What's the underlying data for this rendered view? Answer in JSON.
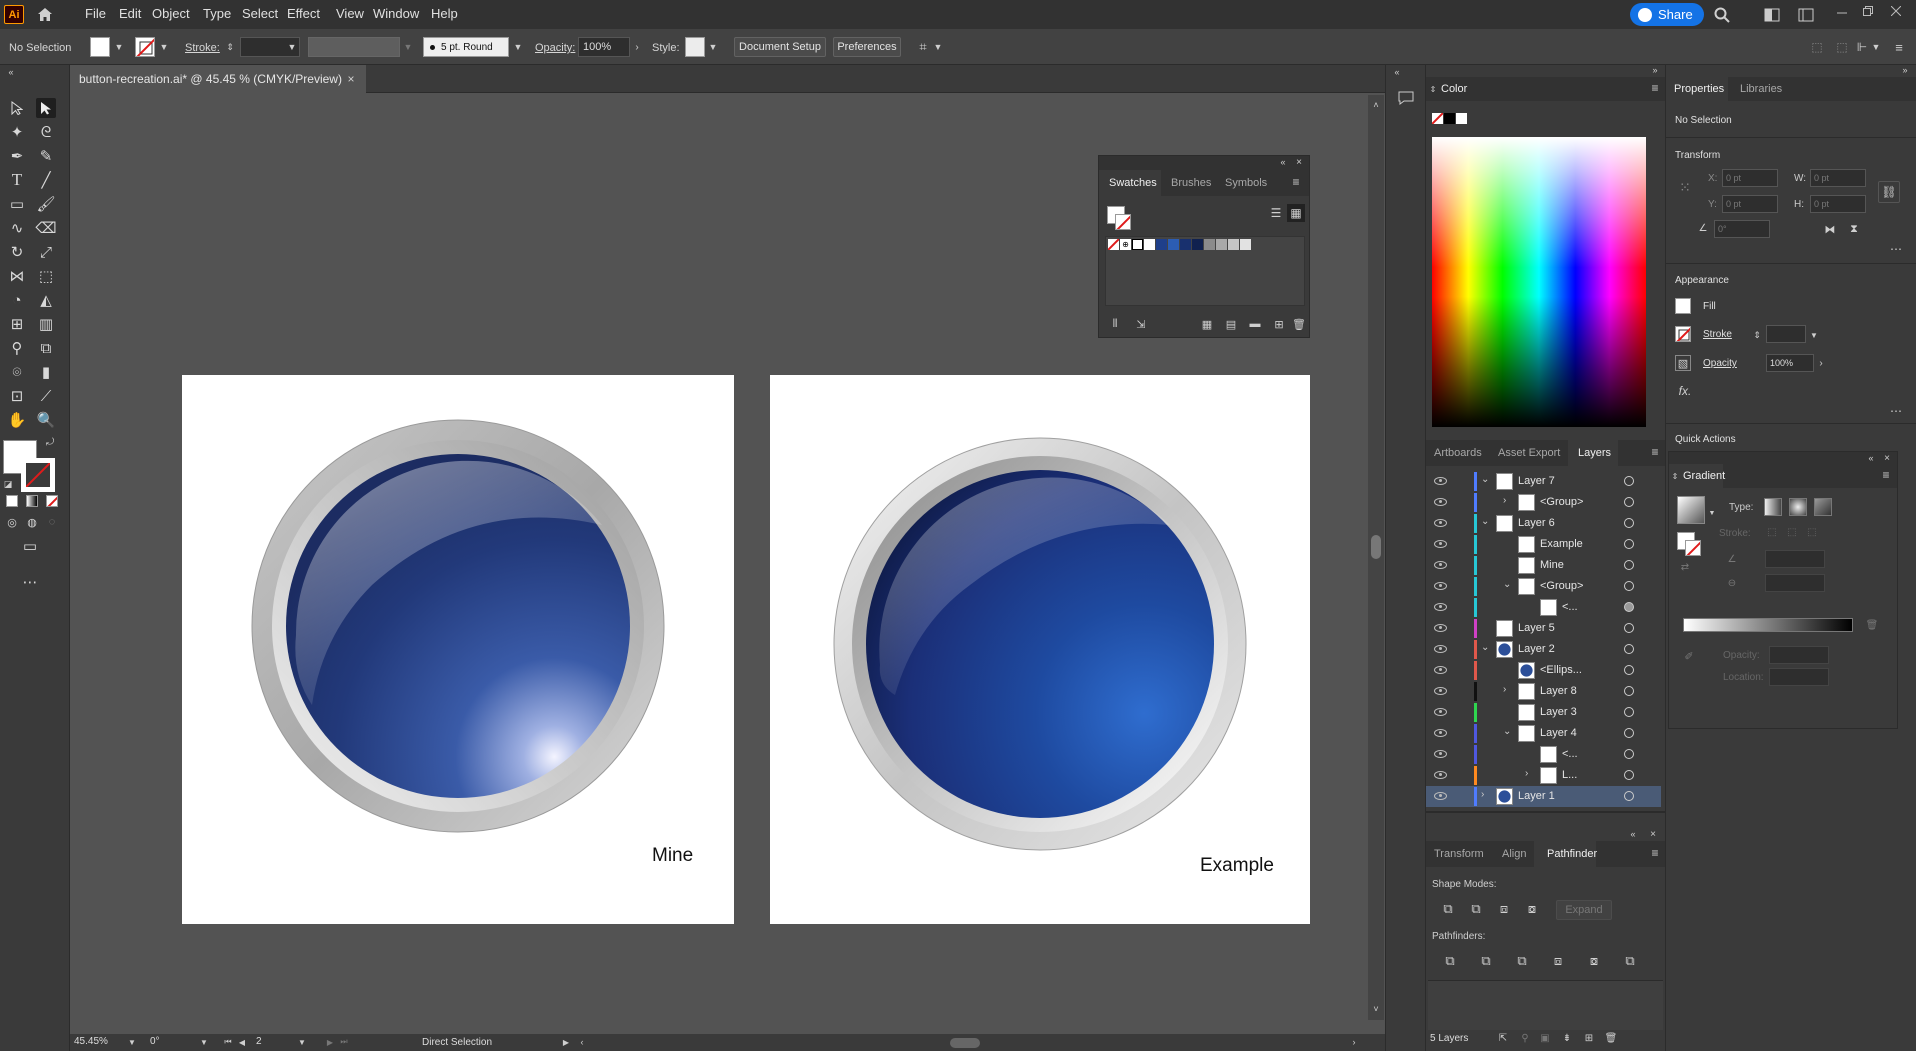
{
  "app": {
    "logo": "Ai",
    "brand_color": "#ff9a00"
  },
  "menu": [
    "File",
    "Edit",
    "Object",
    "Type",
    "Select",
    "Effect",
    "View",
    "Window",
    "Help"
  ],
  "share": {
    "label": "Share",
    "color": "#1473e6"
  },
  "control": {
    "selection": "No Selection",
    "stroke_label": "Stroke:",
    "brush": "5 pt. Round",
    "opacity_label": "Opacity:",
    "opacity_value": "100%",
    "style_label": "Style:",
    "doc_setup": "Document Setup",
    "preferences": "Preferences"
  },
  "document": {
    "tab_title": "button-recreation.ai* @ 45.45 % (CMYK/Preview)"
  },
  "artboards": [
    {
      "label": "Mine"
    },
    {
      "label": "Example"
    }
  ],
  "swatches_panel": {
    "tabs": [
      "Swatches",
      "Brushes",
      "Symbols"
    ],
    "colors": [
      "#1f3f8a",
      "#2c5db3",
      "#18306e",
      "#10214f",
      "#8b8b8b",
      "#a9a9a9",
      "#c6c6c6",
      "#e2e2e2"
    ]
  },
  "color_panel": {
    "title": "Color"
  },
  "layers_panel": {
    "tabs": [
      "Artboards",
      "Asset Export",
      "Layers"
    ],
    "rows": [
      {
        "name": "Layer 7",
        "color": "#4f7cff",
        "indent": 0,
        "caret": "v"
      },
      {
        "name": "<Group>",
        "color": "#4f7cff",
        "indent": 1,
        "caret": ">"
      },
      {
        "name": "Layer 6",
        "color": "#27c7d6",
        "indent": 0,
        "caret": "v"
      },
      {
        "name": "Example",
        "color": "#27c7d6",
        "indent": 1,
        "caret": ""
      },
      {
        "name": "Mine",
        "color": "#27c7d6",
        "indent": 1,
        "caret": ""
      },
      {
        "name": "<Group>",
        "color": "#27c7d6",
        "indent": 1,
        "caret": "v"
      },
      {
        "name": "<...",
        "color": "#27c7d6",
        "indent": 2,
        "caret": ""
      },
      {
        "name": "Layer 5",
        "color": "#d040c6",
        "indent": 0,
        "caret": ""
      },
      {
        "name": "Layer 2",
        "color": "#e0584b",
        "indent": 0,
        "caret": "v"
      },
      {
        "name": "<Ellips...",
        "color": "#e0584b",
        "indent": 1,
        "caret": ""
      },
      {
        "name": "Layer 8",
        "color": "#111111",
        "indent": 1,
        "caret": ">"
      },
      {
        "name": "Layer 3",
        "color": "#2fd64f",
        "indent": 1,
        "caret": ""
      },
      {
        "name": "Layer 4",
        "color": "#4f58e0",
        "indent": 1,
        "caret": "v"
      },
      {
        "name": "<...",
        "color": "#4f58e0",
        "indent": 2,
        "caret": ""
      },
      {
        "name": "L...",
        "color": "#ff8a1f",
        "indent": 2,
        "caret": ">"
      },
      {
        "name": "Layer 1",
        "color": "#4f7cff",
        "indent": 0,
        "caret": ">"
      }
    ],
    "footer": "5 Layers"
  },
  "pathfinder_panel": {
    "tabs": [
      "Transform",
      "Align",
      "Pathfinder"
    ],
    "shape_modes": "Shape Modes:",
    "pathfinders": "Pathfinders:",
    "expand": "Expand"
  },
  "properties": {
    "tabs": [
      "Properties",
      "Libraries"
    ],
    "selection": "No Selection",
    "transform": "Transform",
    "x_label": "X:",
    "y_label": "Y:",
    "w_label": "W:",
    "h_label": "H:",
    "pt_placeholder": "0 pt",
    "angle_placeholder": "0°",
    "appearance": "Appearance",
    "fill": "Fill",
    "stroke": "Stroke",
    "opacity": "Opacity",
    "opacity_value": "100%",
    "fx": "fx.",
    "quick_actions": "Quick Actions"
  },
  "gradient_panel": {
    "title": "Gradient",
    "type": "Type:",
    "stroke": "Stroke:",
    "opacity": "Opacity:",
    "location": "Location:"
  },
  "status": {
    "zoom": "45.45%",
    "rotation": "0°",
    "artboard_num": "2",
    "tool": "Direct Selection"
  }
}
